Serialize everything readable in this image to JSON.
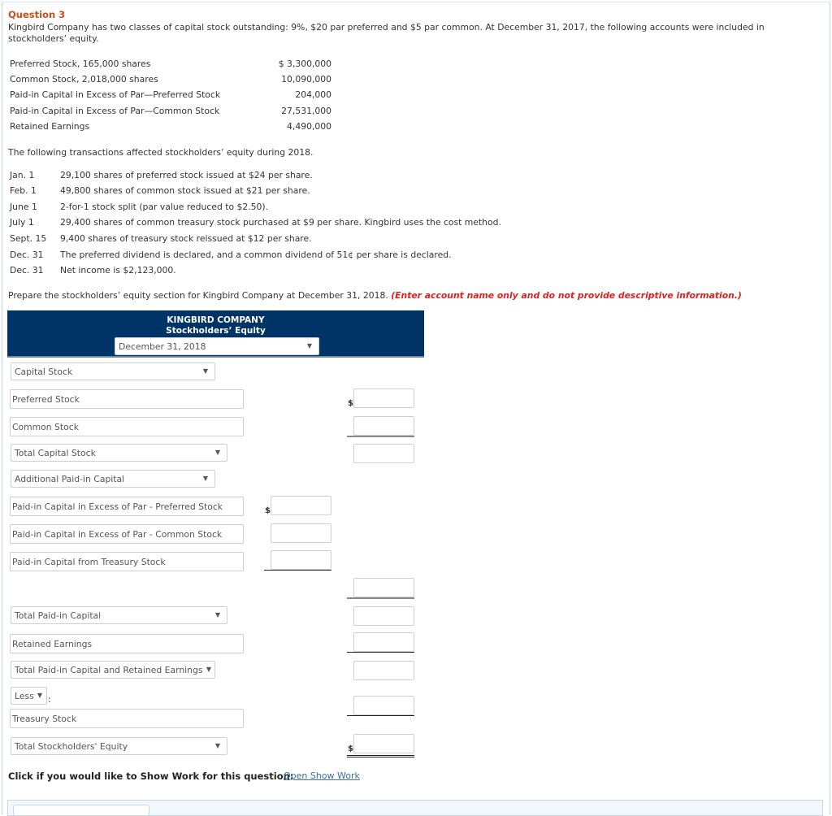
{
  "question": {
    "title": "Question 3",
    "intro": "Kingbird Company has two classes of capital stock outstanding: 9%, $20 par preferred and $5 par common. At December 31, 2017, the following accounts were included in stockholders’ equity."
  },
  "accounts": [
    {
      "label": "Preferred Stock, 165,000 shares",
      "value": "$ 3,300,000"
    },
    {
      "label": "Common Stock, 2,018,000 shares",
      "value": "10,090,000"
    },
    {
      "label": "Paid-in Capital in Excess of Par—Preferred Stock",
      "value": "204,000"
    },
    {
      "label": "Paid-in Capital in Excess of Par—Common Stock",
      "value": "27,531,000"
    },
    {
      "label": "Retained Earnings",
      "value": "4,490,000"
    }
  ],
  "transactions_intro": "The following transactions affected stockholders’ equity during 2018.",
  "transactions": [
    {
      "date": "Jan. 1",
      "desc": "29,100 shares of preferred stock issued at $24 per share."
    },
    {
      "date": "Feb. 1",
      "desc": "49,800 shares of common stock issued at $21 per share."
    },
    {
      "date": "June 1",
      "desc": "2-for-1 stock split (par value reduced to $2.50)."
    },
    {
      "date": "July 1",
      "desc": "29,400 shares of common treasury stock purchased at $9 per share. Kingbird uses the cost method."
    },
    {
      "date": "Sept. 15",
      "desc": "9,400 shares of treasury stock reissued at $12 per share."
    },
    {
      "date": "Dec. 31",
      "desc": "The preferred dividend is declared, and a common dividend of 51¢ per share is declared."
    },
    {
      "date": "Dec. 31",
      "desc": "Net income is $2,123,000."
    }
  ],
  "instructions": {
    "text": "Prepare the stockholders’ equity section for Kingbird Company at December 31, 2018.",
    "note": "(Enter account name only and do not provide descriptive information.)"
  },
  "statement": {
    "company": "KINGBIRD COMPANY",
    "title": "Stockholders’ Equity",
    "date_select": "December 31, 2018",
    "rows": {
      "capital_stock_select": "Capital Stock",
      "preferred_stock": "Preferred Stock",
      "common_stock": "Common Stock",
      "total_capital_stock_select": "Total Capital Stock",
      "additional_pic_select": "Additional Paid-in Capital",
      "pic_excess_preferred": "Paid-in Capital in Excess of Par - Preferred Stock",
      "pic_excess_common": "Paid-in Capital in Excess of Par - Common Stock",
      "pic_treasury": "Paid-in Capital from Treasury Stock",
      "total_pic_select": "Total Paid-in Capital",
      "retained_earnings": "Retained Earnings",
      "total_pic_re_select": "Total Paid-in Capital and Retained Earnings",
      "less_select": "Less",
      "less_colon": ":",
      "treasury_stock": "Treasury Stock",
      "total_se_select": "Total Stockholders' Equity"
    },
    "currency_symbol": "$",
    "dropdown_arrow": "▼"
  },
  "show_work": {
    "prompt": "Click if you would like to Show Work for this question:",
    "link": "Open Show Work"
  }
}
